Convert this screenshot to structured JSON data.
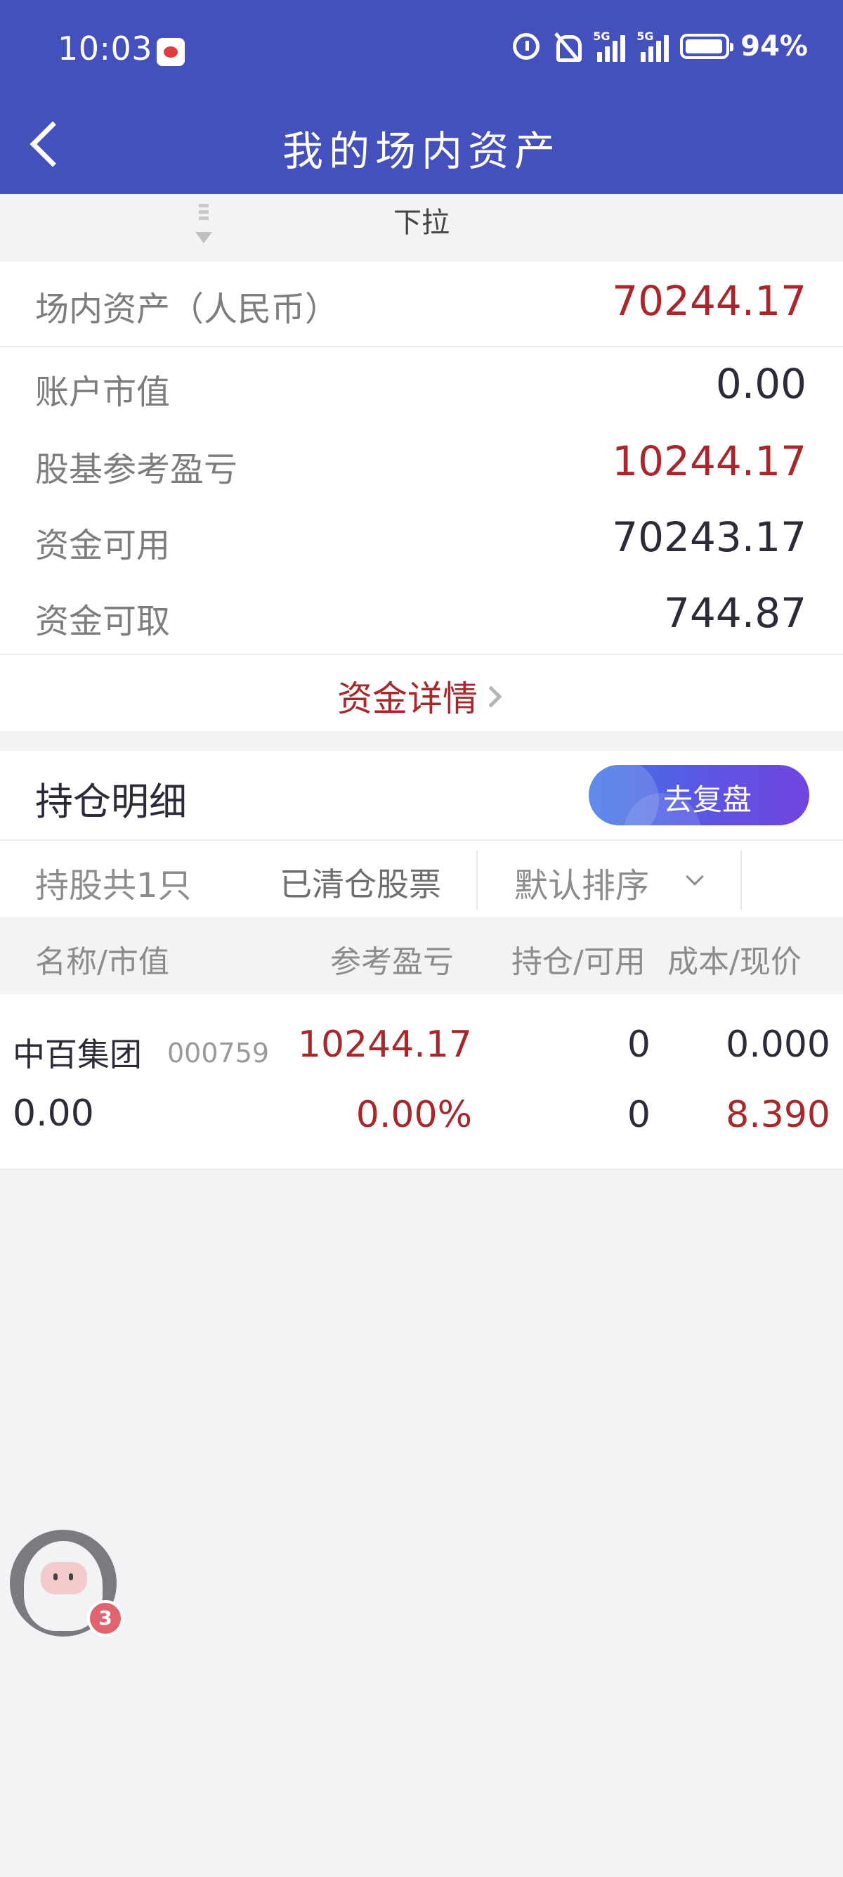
{
  "status_bar": {
    "time": "10:03",
    "signal_1": "5G",
    "signal_2": "5G",
    "battery": "94%"
  },
  "header": {
    "title": "我的场内资产"
  },
  "pull_hint": "下拉",
  "assets": {
    "header_label": "场内资产（人民币）",
    "header_value": "70244.17",
    "rows": [
      {
        "label": "账户市值",
        "value": "0.00"
      },
      {
        "label": "股基参考盈亏",
        "value": "10244.17"
      },
      {
        "label": "资金可用",
        "value": "70243.17"
      },
      {
        "label": "资金可取",
        "value": "744.87"
      }
    ],
    "detail_link": "资金详情"
  },
  "holdings": {
    "title": "持仓明细",
    "review_button": "去复盘",
    "count_label": "持股共1只",
    "cleared_label": "已清仓股票",
    "sort_label": "默认排序",
    "columns": [
      "名称/市值",
      "参考盈亏",
      "持仓/可用",
      "成本/现价"
    ],
    "rows": [
      {
        "name": "中百集团",
        "code": "000759",
        "market_value": "0.00",
        "pnl": "10244.17",
        "pnl_pct": "0.00%",
        "position": "0",
        "available": "0",
        "cost": "0.000",
        "price": "8.390"
      }
    ]
  },
  "assistant": {
    "badge": "3"
  },
  "colors": {
    "header_bg": "#4450bb",
    "accent_red": "#a8272b",
    "page_bg": "#f2f3f5"
  }
}
